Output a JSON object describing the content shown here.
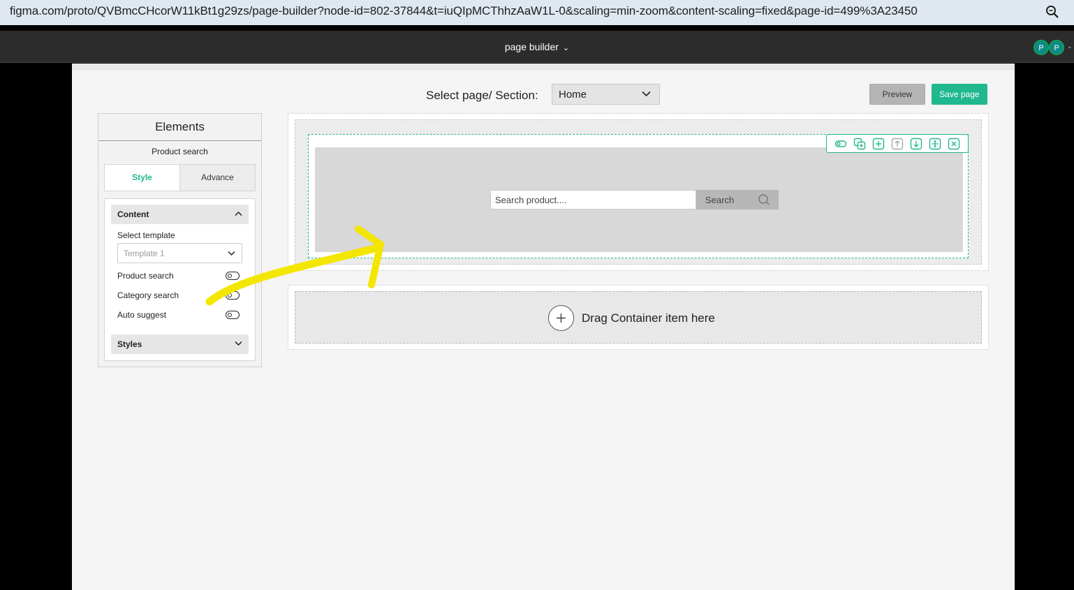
{
  "browser": {
    "url": "figma.com/proto/QVBmcCHcorW11kBt1g29zs/page-builder?node-id=802-37844&t=iuQIpMCThhzAaW1L-0&scaling=min-zoom&content-scaling=fixed&page-id=499%3A23450",
    "zoom_icon": "zoom-icon"
  },
  "figma": {
    "file_title": "page builder",
    "avatars": [
      "P",
      "P"
    ]
  },
  "header": {
    "select_label": "Select page/ Section:",
    "select_value": "Home",
    "preview_label": "Preview",
    "save_label": "Save page"
  },
  "panel": {
    "title": "Elements",
    "subtitle": "Product search",
    "tabs": [
      "Style",
      "Advance"
    ],
    "content_label": "Content",
    "select_template_label": "Select template",
    "template_value": "Template 1",
    "toggles": [
      "Product search",
      "Category search",
      "Auto suggest"
    ],
    "styles_label": "Styles"
  },
  "canvas": {
    "search_placeholder": "Search product....",
    "search_button": "Search",
    "toolbar_icons": [
      "toggle-icon",
      "copy-icon",
      "add-icon",
      "move-up-icon",
      "move-down-icon",
      "move-icon",
      "close-icon"
    ],
    "drag_text": "Drag Container item here"
  },
  "colors": {
    "accent": "#20b88f",
    "annotation": "#f3e600"
  }
}
